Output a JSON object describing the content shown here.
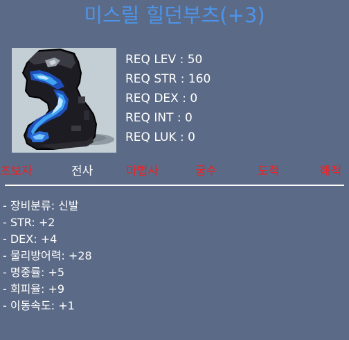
{
  "item": {
    "name": "미스릴 힐던부츠(+3)",
    "name_color": "#4d94ea",
    "image_icon": "mithril-hildon-boots-icon"
  },
  "requirements": [
    "REQ LEV : 50",
    "REQ STR : 160",
    "REQ DEX : 0",
    "REQ INT : 0",
    "REQ LUK : 0"
  ],
  "jobs": {
    "beginner": {
      "label": "초보자",
      "eligible": false
    },
    "warrior": {
      "label": "전사",
      "eligible": true
    },
    "magician": {
      "label": "마법사",
      "eligible": false
    },
    "bowman": {
      "label": "궁수",
      "eligible": false
    },
    "thief": {
      "label": "도적",
      "eligible": false
    },
    "pirate": {
      "label": "해적",
      "eligible": false
    },
    "eligible_color": "#ffffff",
    "ineligible_color": "#ff1a1a"
  },
  "stats": [
    "- 장비분류: 신발",
    "- STR: +2",
    "- DEX: +4",
    "- 물리방어력: +28",
    "- 명중률: +5",
    "- 회피율: +9",
    "- 이동속도: +1"
  ],
  "colors": {
    "background": "#5b6a86",
    "image_background": "#c3ced5"
  }
}
